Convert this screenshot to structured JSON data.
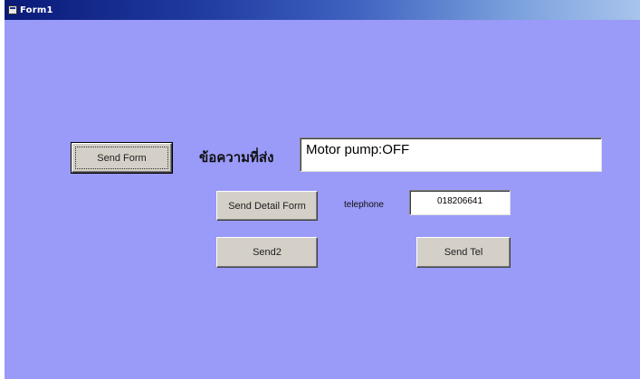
{
  "window": {
    "title": "Form1"
  },
  "buttons": {
    "send_form": "Send Form",
    "send_detail_form": "Send Detail Form",
    "send2": "Send2",
    "send_tel": "Send Tel"
  },
  "message": {
    "label": "ข้อความที่ส่ง",
    "value": "Motor pump:OFF"
  },
  "telephone": {
    "label": "telephone",
    "value": "018206641"
  }
}
